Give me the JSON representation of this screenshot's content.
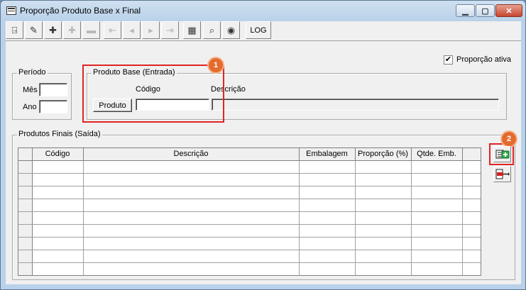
{
  "window": {
    "title": "Proporção Produto Base x Final"
  },
  "toolbar": {
    "buttons": [
      {
        "icon": "exit-door-icon",
        "glyph": "⍈",
        "enabled": true
      },
      {
        "icon": "eraser-icon",
        "glyph": "✎",
        "enabled": true
      },
      {
        "icon": "add-record-icon",
        "glyph": "✚",
        "enabled": true
      },
      {
        "icon": "edit-record-icon",
        "glyph": "✚",
        "enabled": false
      },
      {
        "icon": "delete-record-icon",
        "glyph": "▬",
        "enabled": false
      },
      {
        "icon": "first-record-icon",
        "glyph": "⇤",
        "enabled": false
      },
      {
        "icon": "previous-record-icon",
        "glyph": "◂",
        "enabled": false
      },
      {
        "icon": "next-record-icon",
        "glyph": "▸",
        "enabled": false
      },
      {
        "icon": "last-record-icon",
        "glyph": "⇥",
        "enabled": false
      },
      {
        "icon": "spreadsheet-icon",
        "glyph": "▦",
        "enabled": true
      },
      {
        "icon": "binoculars-icon",
        "glyph": "⌕",
        "enabled": true
      },
      {
        "icon": "camera-icon",
        "glyph": "◉",
        "enabled": true
      }
    ],
    "log_label": "LOG"
  },
  "proporcao_ativa": {
    "label": "Proporção ativa",
    "checked": true
  },
  "periodo": {
    "legend": "Período",
    "mes_label": "Mês",
    "mes_value": "",
    "ano_label": "Ano",
    "ano_value": ""
  },
  "produto_base": {
    "legend": "Produto Base (Entrada)",
    "codigo_label": "Código",
    "descricao_label": "Descrição",
    "produto_button": "Produto",
    "codigo_value": "",
    "descricao_value": ""
  },
  "produtos_finais": {
    "legend": "Produtos Finais (Saída)",
    "columns": [
      "Código",
      "Descrição",
      "Embalagem",
      "Proporção (%)",
      "Qtde. Emb."
    ],
    "rows": [
      [
        "",
        "",
        "",
        "",
        ""
      ],
      [
        "",
        "",
        "",
        "",
        ""
      ],
      [
        "",
        "",
        "",
        "",
        ""
      ],
      [
        "",
        "",
        "",
        "",
        ""
      ],
      [
        "",
        "",
        "",
        "",
        ""
      ],
      [
        "",
        "",
        "",
        "",
        ""
      ],
      [
        "",
        "",
        "",
        "",
        ""
      ],
      [
        "",
        "",
        "",
        "",
        ""
      ],
      [
        "",
        "",
        "",
        "",
        ""
      ]
    ]
  },
  "callouts": [
    "1",
    "2"
  ],
  "colors": {
    "callout_border": "#e02424",
    "callout_badge": "#e46b2e"
  }
}
